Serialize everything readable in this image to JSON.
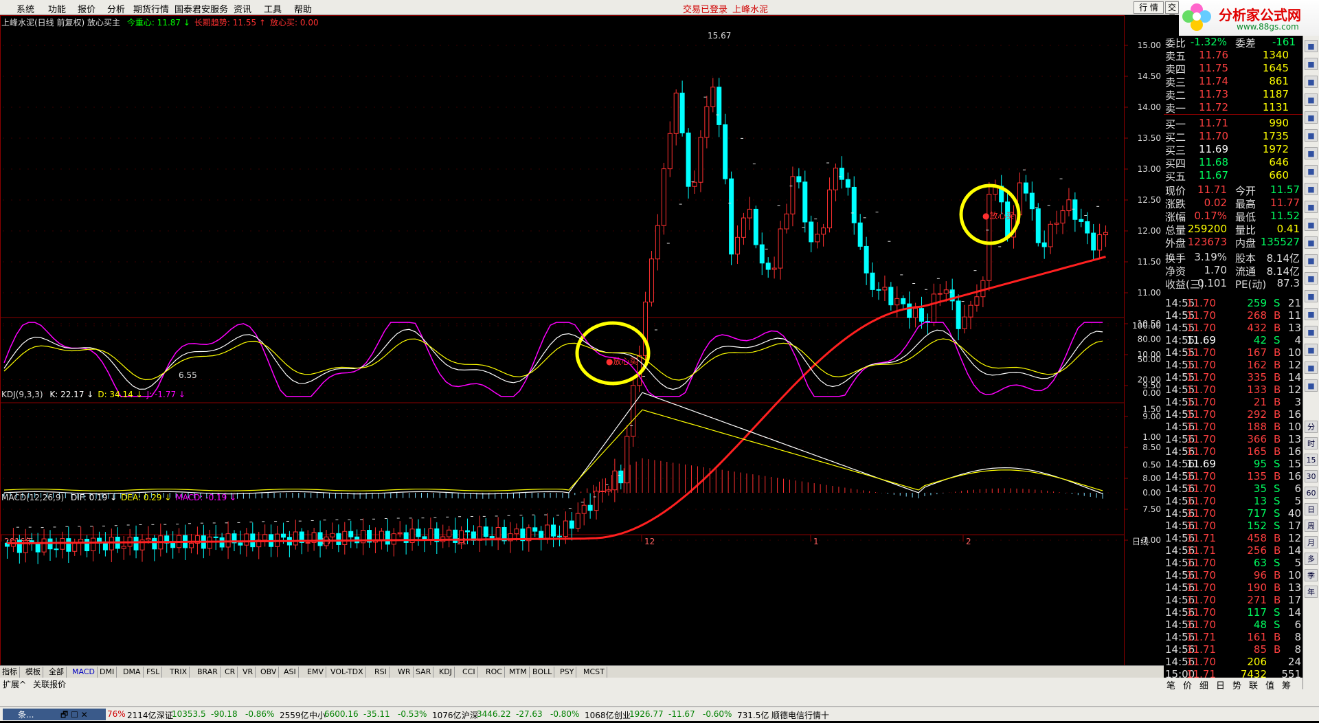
{
  "menu": {
    "items": [
      "系统",
      "功能",
      "报价",
      "分析",
      "期货行情",
      "国泰君安服务",
      "资讯",
      "工具",
      "帮助"
    ],
    "status": [
      "交易已登录",
      "上峰水泥"
    ],
    "buttons": [
      "行 情",
      "交易"
    ]
  },
  "logo": {
    "brand": "分析家公式网",
    "url": "www.88gs.com"
  },
  "main": {
    "title": "上峰水泥(日线 前复权) 放心买主",
    "legend": [
      {
        "label": "今重心: 11.87",
        "color": "#00ff00",
        "arrow": "↓"
      },
      {
        "label": "长期趋势: 11.55",
        "color": "#ff3030",
        "arrow": "↑"
      },
      {
        "label": "放心买: 0.00",
        "color": "#ff3030",
        "arrow": ""
      }
    ],
    "y_ticks": [
      "15.00",
      "14.50",
      "14.00",
      "13.50",
      "13.00",
      "12.50",
      "12.00",
      "11.50",
      "11.00",
      "10.50",
      "10.00",
      "9.50",
      "9.00",
      "8.50",
      "8.00",
      "7.50",
      "7.00"
    ],
    "annotations": {
      "high": "15.67",
      "low": "6.55",
      "buy1": "●放心买",
      "buy2": "●放心买"
    }
  },
  "kdj": {
    "title": "KDJ(9,3,3)",
    "legend": [
      {
        "label": "K: 22.17",
        "color": "#ffffff",
        "arrow": "↓"
      },
      {
        "label": "D: 34.14",
        "color": "#ffff00",
        "arrow": "↓"
      },
      {
        "label": "J: -1.77",
        "color": "#ff00ff",
        "arrow": "↓"
      }
    ],
    "y_ticks": [
      "100.00",
      "80.00",
      "50.00",
      "20.00",
      "0.00"
    ]
  },
  "macd": {
    "title": "MACD(12,26,9)",
    "legend": [
      {
        "label": "DIF: 0.19",
        "color": "#ffffff",
        "arrow": "↓"
      },
      {
        "label": "DEA: 0.29",
        "color": "#ffff00",
        "arrow": "↓"
      },
      {
        "label": "MACD: -0.19",
        "color": "#ff00ff",
        "arrow": "↓"
      }
    ],
    "y_ticks": [
      "1.50",
      "1.00",
      "0.50",
      "0.00"
    ]
  },
  "x_axis": {
    "labels": [
      "2016年",
      "9",
      "10",
      "11",
      "12",
      "1",
      "2"
    ],
    "period": "日线"
  },
  "tabs": [
    "指标",
    "模板",
    "全部",
    "MACD",
    "DMI",
    "DMA",
    "FSL",
    "TRIX",
    "BRAR",
    "CR",
    "VR",
    "OBV",
    "ASI",
    "EMV",
    "VOL-TDX",
    "RSI",
    "WR",
    "SAR",
    "KDJ",
    "CCI",
    "ROC",
    "MTM",
    "BOLL",
    "PSY",
    "MCST"
  ],
  "expand": [
    "扩展^",
    "关联报价"
  ],
  "panel": {
    "wb": {
      "label": "委比",
      "pct": "-1.32%",
      "label2": "委差",
      "val": "-161"
    },
    "sells": [
      {
        "l": "卖五",
        "p": "11.76",
        "v": "1340"
      },
      {
        "l": "卖四",
        "p": "11.75",
        "v": "1645"
      },
      {
        "l": "卖三",
        "p": "11.74",
        "v": "861"
      },
      {
        "l": "卖二",
        "p": "11.73",
        "v": "1187"
      },
      {
        "l": "卖一",
        "p": "11.72",
        "v": "1131"
      }
    ],
    "buys": [
      {
        "l": "买一",
        "p": "11.71",
        "v": "990"
      },
      {
        "l": "买二",
        "p": "11.70",
        "v": "1735"
      },
      {
        "l": "买三",
        "p": "11.69",
        "v": "1972"
      },
      {
        "l": "买四",
        "p": "11.68",
        "v": "646"
      },
      {
        "l": "买五",
        "p": "11.67",
        "v": "660"
      }
    ],
    "quote": [
      {
        "a": "现价",
        "b": "11.71",
        "bc": "#ff4040",
        "c": "今开",
        "d": "11.57",
        "dc": "#00ff60"
      },
      {
        "a": "涨跌",
        "b": "0.02",
        "bc": "#ff4040",
        "c": "最高",
        "d": "11.77",
        "dc": "#ff4040"
      },
      {
        "a": "涨幅",
        "b": "0.17%",
        "bc": "#ff4040",
        "c": "最低",
        "d": "11.52",
        "dc": "#00ff60"
      },
      {
        "a": "总量",
        "b": "259200",
        "bc": "#ffff00",
        "c": "量比",
        "d": "0.41",
        "dc": "#ffff00"
      },
      {
        "a": "外盘",
        "b": "123673",
        "bc": "#ff4040",
        "c": "内盘",
        "d": "135527",
        "dc": "#00ff60"
      }
    ],
    "fund": [
      {
        "a": "换手",
        "b": "3.19%",
        "c": "股本",
        "d": "8.14亿"
      },
      {
        "a": "净资",
        "b": "1.70",
        "c": "流通",
        "d": "8.14亿"
      },
      {
        "a": "收益(三)",
        "b": "0.101",
        "c": "PE(动)",
        "d": "87.3"
      }
    ],
    "trades": [
      [
        "14:55",
        "11.70",
        "259",
        "S",
        "21"
      ],
      [
        "14:55",
        "11.70",
        "268",
        "B",
        "11"
      ],
      [
        "14:55",
        "11.70",
        "432",
        "B",
        "13"
      ],
      [
        "14:55",
        "11.69",
        "42",
        "S",
        "4"
      ],
      [
        "14:55",
        "11.70",
        "167",
        "B",
        "10"
      ],
      [
        "14:55",
        "11.70",
        "162",
        "B",
        "12"
      ],
      [
        "14:55",
        "11.70",
        "335",
        "B",
        "14"
      ],
      [
        "14:55",
        "11.70",
        "133",
        "B",
        "12"
      ],
      [
        "14:55",
        "11.70",
        "21",
        "B",
        "3"
      ],
      [
        "14:55",
        "11.70",
        "292",
        "B",
        "16"
      ],
      [
        "14:56",
        "11.70",
        "188",
        "B",
        "10"
      ],
      [
        "14:56",
        "11.70",
        "366",
        "B",
        "13"
      ],
      [
        "14:56",
        "11.70",
        "165",
        "B",
        "16"
      ],
      [
        "14:56",
        "11.69",
        "95",
        "S",
        "15"
      ],
      [
        "14:56",
        "11.70",
        "135",
        "B",
        "16"
      ],
      [
        "14:56",
        "11.70",
        "35",
        "S",
        "6"
      ],
      [
        "14:56",
        "11.70",
        "13",
        "S",
        "5"
      ],
      [
        "14:56",
        "11.70",
        "717",
        "S",
        "40"
      ],
      [
        "14:56",
        "11.70",
        "152",
        "S",
        "17"
      ],
      [
        "14:56",
        "11.71",
        "458",
        "B",
        "12"
      ],
      [
        "14:56",
        "11.71",
        "256",
        "B",
        "14"
      ],
      [
        "14:56",
        "11.70",
        "63",
        "S",
        "5"
      ],
      [
        "14:56",
        "11.70",
        "96",
        "B",
        "10"
      ],
      [
        "14:56",
        "11.70",
        "190",
        "B",
        "13"
      ],
      [
        "14:56",
        "11.70",
        "271",
        "B",
        "17"
      ],
      [
        "14:56",
        "11.70",
        "117",
        "S",
        "14"
      ],
      [
        "14:56",
        "11.70",
        "48",
        "S",
        "6"
      ],
      [
        "14:56",
        "11.71",
        "161",
        "B",
        "8"
      ],
      [
        "14:56",
        "11.71",
        "85",
        "B",
        "8"
      ],
      [
        "14:56",
        "11.70",
        "206",
        "",
        "24"
      ],
      [
        "15:00",
        "11.71",
        "7432",
        "",
        "551"
      ]
    ],
    "bottom_tabs": [
      "笔",
      "价",
      "细",
      "日",
      "势",
      "联",
      "值",
      "筹"
    ]
  },
  "right_tools": [
    "分",
    "时",
    "15",
    "30",
    "60",
    "日",
    "周",
    "月",
    "多",
    "季",
    "年"
  ],
  "taskbar": {
    "window": "条...",
    "items": [
      {
        "t": "76%",
        "c": "#d00000"
      },
      {
        "t": "2114亿",
        "c": "#000"
      },
      {
        "t": "深证",
        "c": "#000"
      },
      {
        "t": "10353.5",
        "c": "#008000"
      },
      {
        "t": "-90.18",
        "c": "#008000"
      },
      {
        "t": "-0.86%",
        "c": "#008000"
      },
      {
        "t": "2559亿",
        "c": "#000"
      },
      {
        "t": "中小",
        "c": "#000"
      },
      {
        "t": "6600.16",
        "c": "#008000"
      },
      {
        "t": "-35.11",
        "c": "#008000"
      },
      {
        "t": "-0.53%",
        "c": "#008000"
      },
      {
        "t": "1076亿",
        "c": "#000"
      },
      {
        "t": "沪深",
        "c": "#000"
      },
      {
        "t": "3446.22",
        "c": "#008000"
      },
      {
        "t": "-27.63",
        "c": "#008000"
      },
      {
        "t": "-0.80%",
        "c": "#008000"
      },
      {
        "t": "1068亿",
        "c": "#000"
      },
      {
        "t": "创业",
        "c": "#000"
      },
      {
        "t": "1926.77",
        "c": "#008000"
      },
      {
        "t": "-11.67",
        "c": "#008000"
      },
      {
        "t": "-0.60%",
        "c": "#008000"
      },
      {
        "t": "731.5亿",
        "c": "#000"
      },
      {
        "t": "顺德电信行情十",
        "c": "#000"
      }
    ]
  },
  "colors": {
    "up": "#ff3030",
    "down": "#00ffff",
    "trend": "#ff2020",
    "circle": "#ffff00",
    "grid": "#8b0000"
  }
}
